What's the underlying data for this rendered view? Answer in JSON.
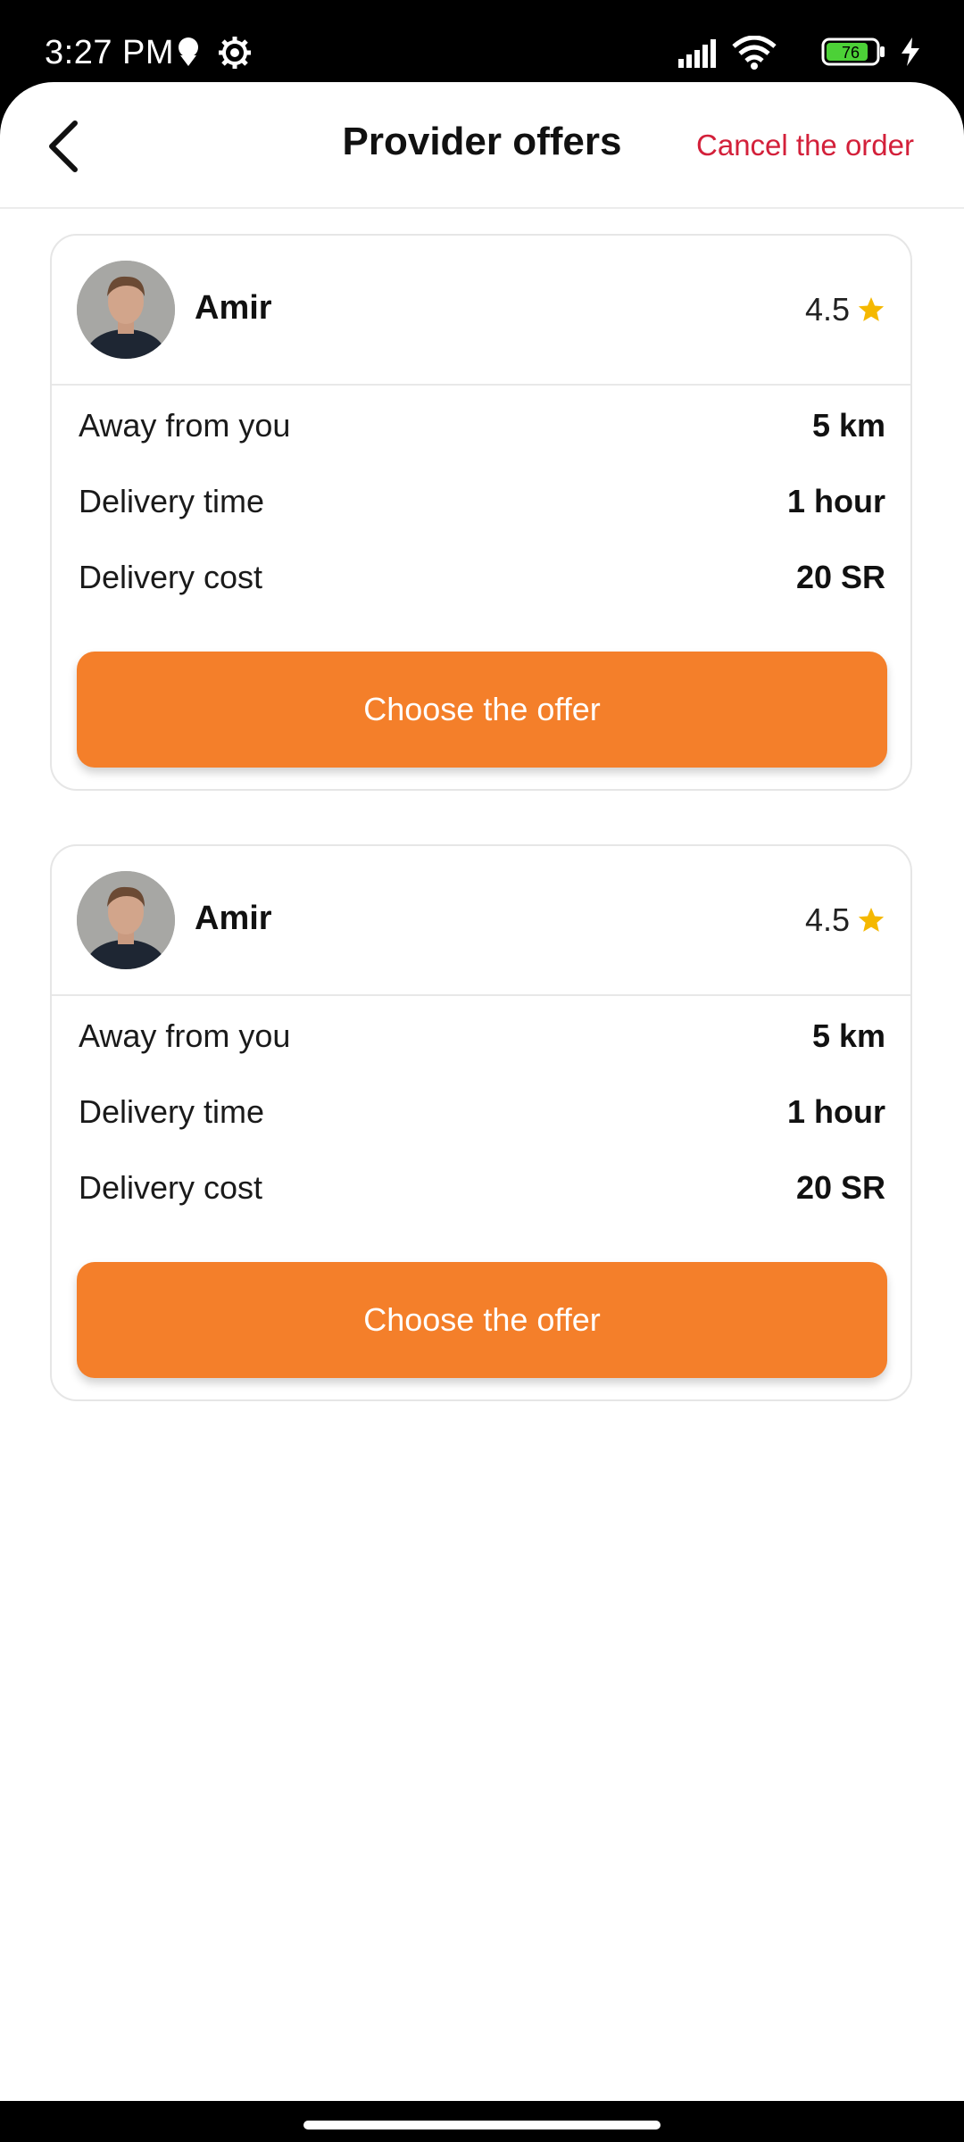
{
  "status_bar": {
    "time": "3:27 PM",
    "battery_level": "76",
    "icons": [
      "notification-icon",
      "settings-gear-icon",
      "signal-icon",
      "wifi-icon",
      "battery-icon",
      "charging-icon"
    ]
  },
  "header": {
    "title": "Provider offers",
    "cancel_label": "Cancel the order",
    "back_icon": "chevron-left-icon"
  },
  "colors": {
    "accent": "#f47f2a",
    "cancel": "#d3203a",
    "star": "#f5b800",
    "battery": "#4cd137"
  },
  "offers": [
    {
      "provider_name": "Amir",
      "rating": "4.5",
      "rows": [
        {
          "label": "Away from you",
          "value": "5 km"
        },
        {
          "label": "Delivery time",
          "value": "1 hour"
        },
        {
          "label": "Delivery cost",
          "value": "20 SR"
        }
      ],
      "button_label": "Choose the offer"
    },
    {
      "provider_name": "Amir",
      "rating": "4.5",
      "rows": [
        {
          "label": "Away from you",
          "value": "5 km"
        },
        {
          "label": "Delivery time",
          "value": "1 hour"
        },
        {
          "label": "Delivery cost",
          "value": "20 SR"
        }
      ],
      "button_label": "Choose the offer"
    }
  ]
}
